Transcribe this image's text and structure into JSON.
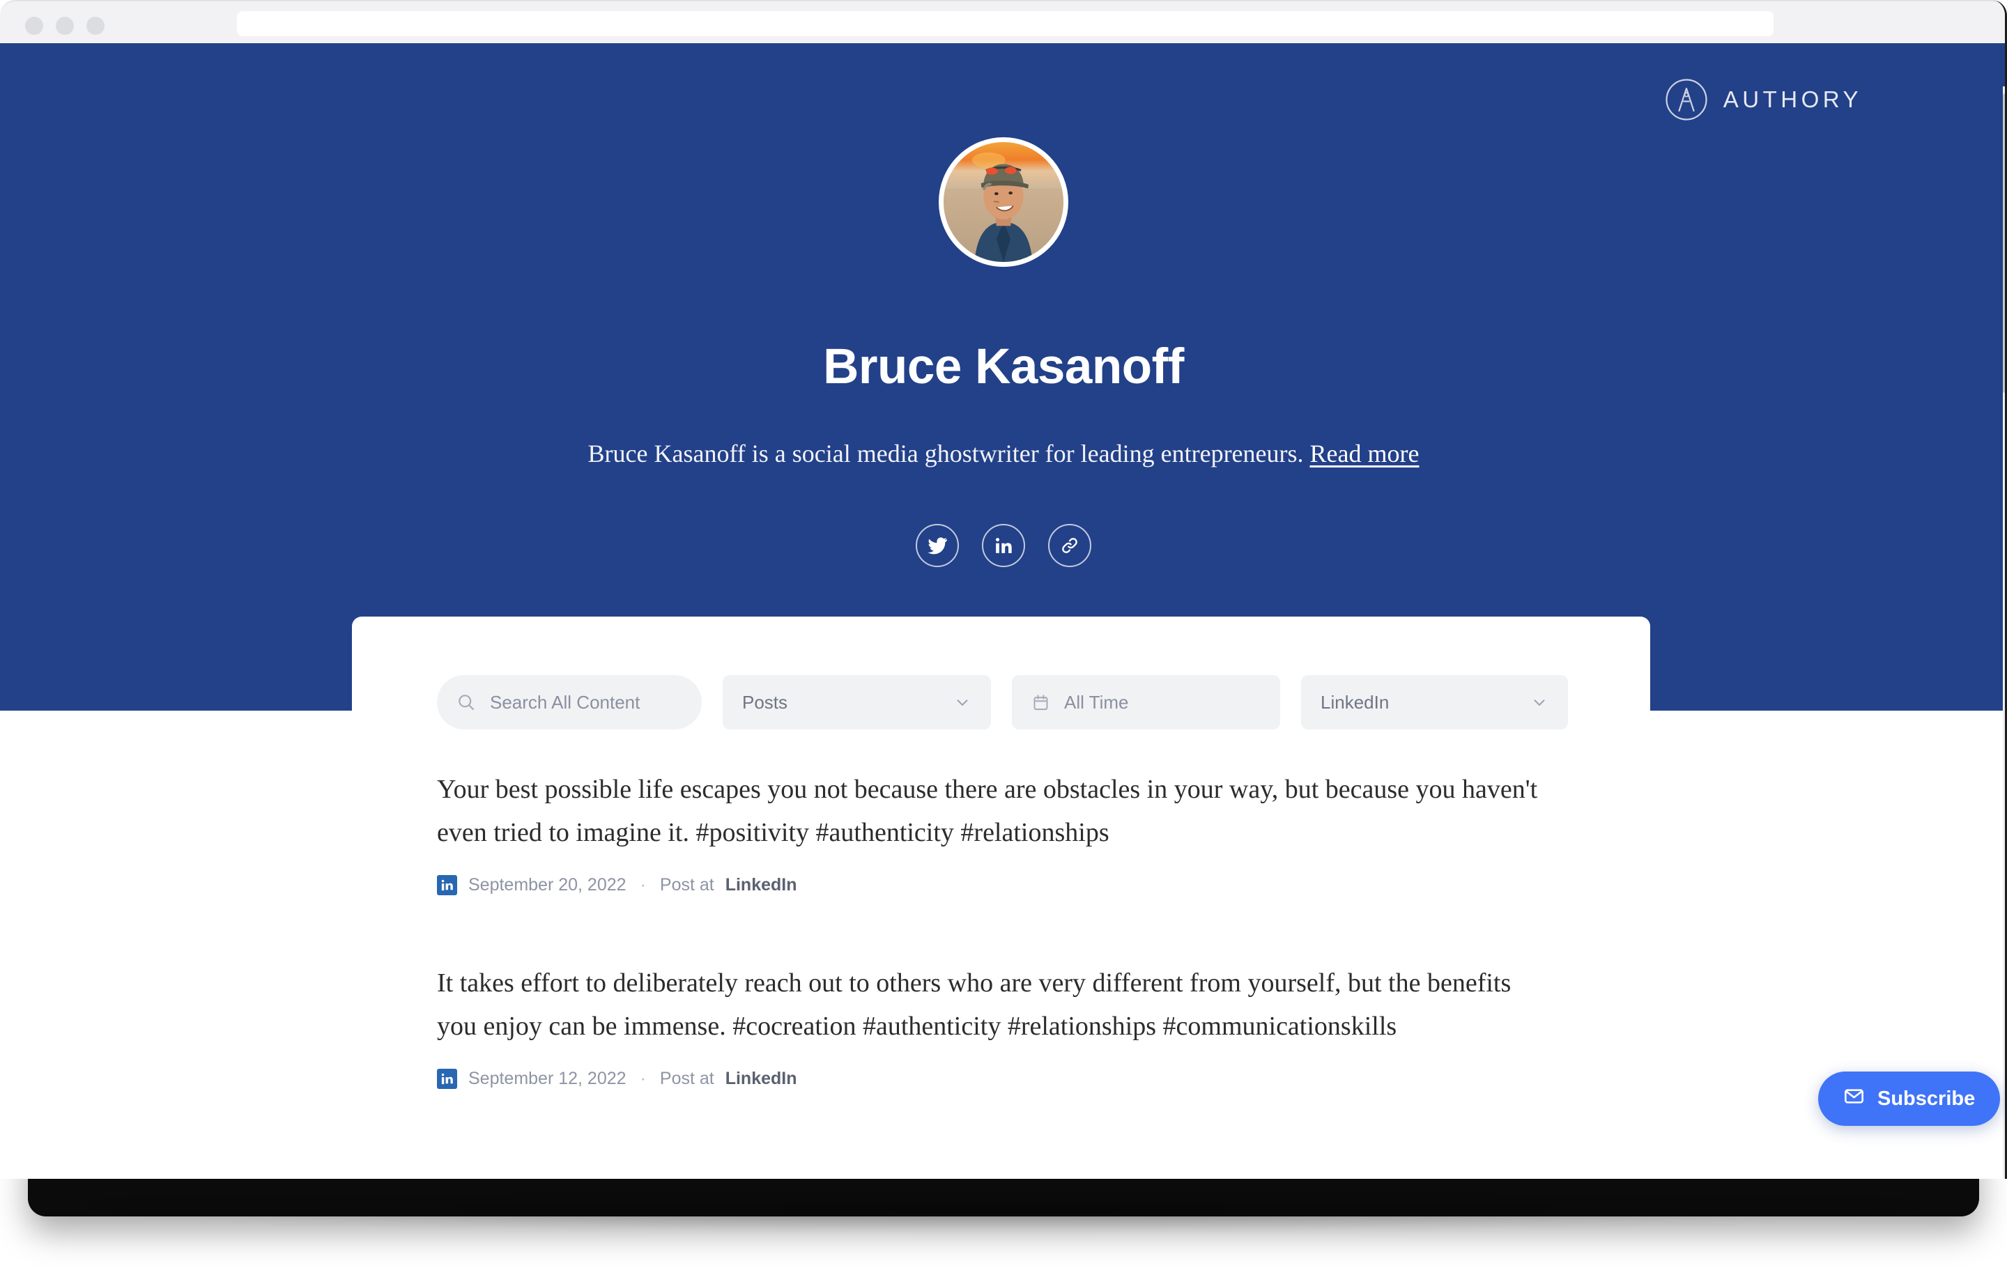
{
  "browser": {
    "url_value": "",
    "url_placeholder": "",
    "traffic_lights": [
      "close",
      "minimize",
      "maximize"
    ]
  },
  "brand": {
    "wordmark": "AUTHORY",
    "mark_icon": "authory-circle-a-icon",
    "blue": "#234189",
    "accent": "#4074f8"
  },
  "profile": {
    "avatar_alt": "Bruce Kasanoff portrait",
    "name": "Bruce Kasanoff",
    "tagline": "Bruce Kasanoff is a social media ghostwriter for leading entrepreneurs.",
    "read_more": "Read more",
    "social": [
      {
        "name": "twitter",
        "icon": "twitter-icon",
        "label": "Twitter"
      },
      {
        "name": "linkedin",
        "icon": "linkedin-icon",
        "label": "LinkedIn"
      },
      {
        "name": "website",
        "icon": "link-icon",
        "label": "Website"
      }
    ]
  },
  "filters": {
    "search": {
      "icon": "search-icon",
      "placeholder": "Search All Content",
      "value": ""
    },
    "type": {
      "value": "Posts",
      "icon": "chevron-down-icon"
    },
    "date": {
      "icon": "calendar-icon",
      "value": "All Time"
    },
    "source": {
      "value": "LinkedIn",
      "icon": "chevron-down-icon"
    }
  },
  "posts": [
    {
      "text": "Your best possible life escapes you not because there are obstacles in your way, but because you haven't even tried to imagine it. #positivity #authenticity #relationships",
      "source_icon": "linkedin-icon",
      "date": "September 20, 2022",
      "separator": "·",
      "source_prefix": "Post at ",
      "source": "LinkedIn"
    },
    {
      "text": "It takes effort to deliberately reach out to others who are very different from yourself, but the benefits you enjoy can be immense. #cocreation #authenticity #relationships #communicationskills",
      "source_icon": "linkedin-icon",
      "date": "September 12, 2022",
      "separator": "·",
      "source_prefix": "Post at ",
      "source": "LinkedIn"
    }
  ],
  "subscribe": {
    "label": "Subscribe",
    "icon": "envelope-icon"
  }
}
